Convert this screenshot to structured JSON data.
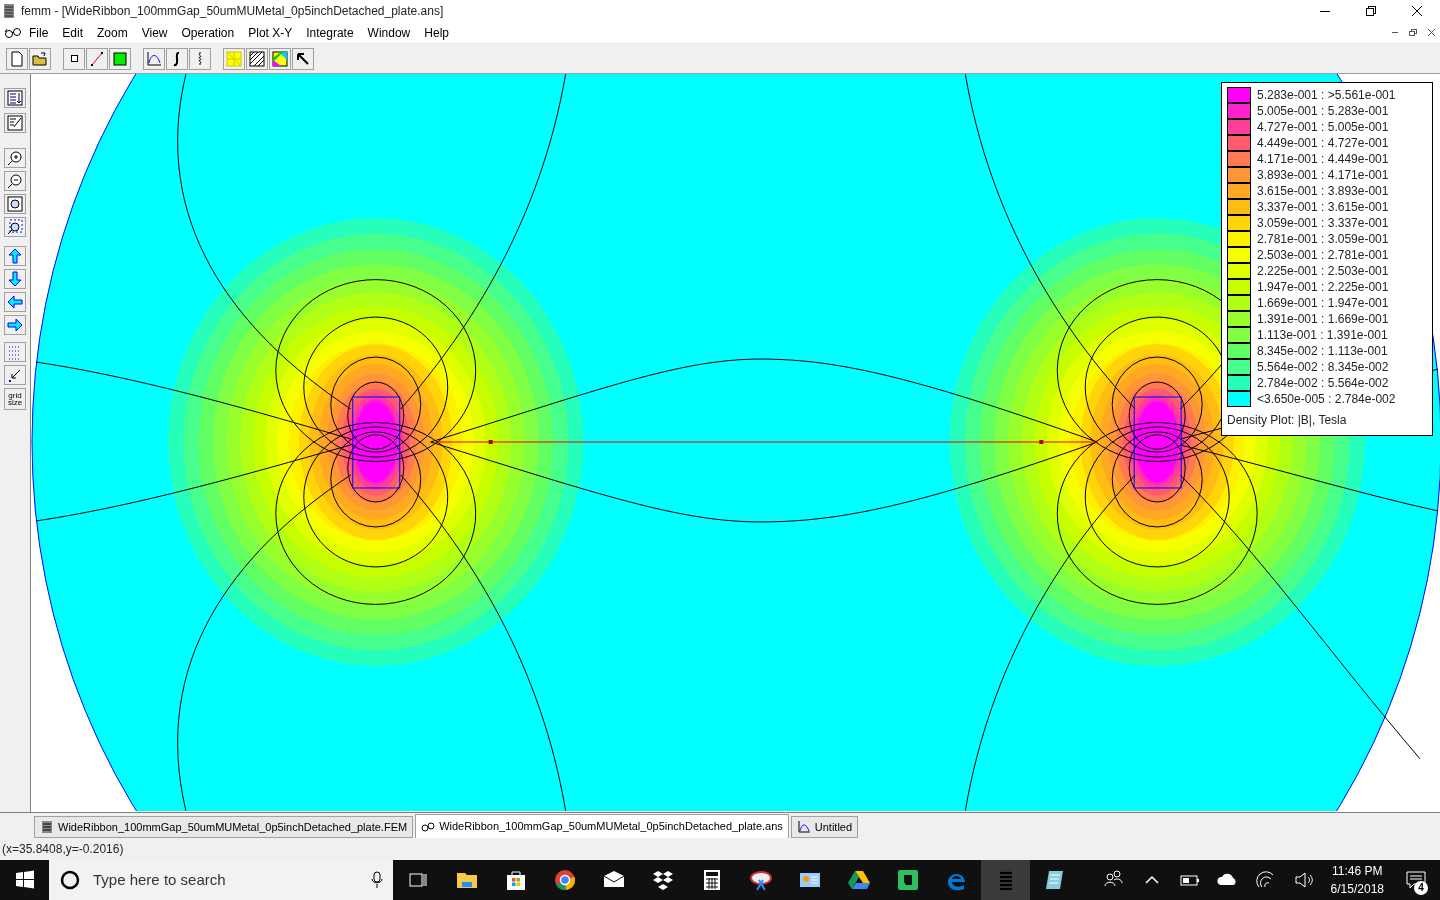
{
  "window": {
    "title": "femm - [WideRibbon_100mmGap_50umMUMetal_0p5inchDetached_plate.ans]"
  },
  "menu": [
    "File",
    "Edit",
    "Zoom",
    "View",
    "Operation",
    "Plot X-Y",
    "Integrate",
    "Window",
    "Help"
  ],
  "side_toolbar": {
    "grid_size_label": "grid size"
  },
  "legend": {
    "rows": [
      {
        "range": "5.283e-001 : >5.561e-001",
        "color": "#ff00ff"
      },
      {
        "range": "5.005e-001 : 5.283e-001",
        "color": "#ff22cc"
      },
      {
        "range": "4.727e-001 : 5.005e-001",
        "color": "#ff3e99"
      },
      {
        "range": "4.449e-001 : 4.727e-001",
        "color": "#ff5a70"
      },
      {
        "range": "4.171e-001 : 4.449e-001",
        "color": "#ff7a50"
      },
      {
        "range": "3.893e-001 : 4.171e-001",
        "color": "#ff9636"
      },
      {
        "range": "3.615e-001 : 3.893e-001",
        "color": "#ffa824"
      },
      {
        "range": "3.337e-001 : 3.615e-001",
        "color": "#ffbc12"
      },
      {
        "range": "3.059e-001 : 3.337e-001",
        "color": "#ffd408"
      },
      {
        "range": "2.781e-001 : 3.059e-001",
        "color": "#fff000"
      },
      {
        "range": "2.503e-001 : 2.781e-001",
        "color": "#f6ff00"
      },
      {
        "range": "2.225e-001 : 2.503e-001",
        "color": "#e0ff00"
      },
      {
        "range": "1.947e-001 : 2.225e-001",
        "color": "#c8ff00"
      },
      {
        "range": "1.669e-001 : 1.947e-001",
        "color": "#b0ff14"
      },
      {
        "range": "1.391e-001 : 1.669e-001",
        "color": "#98ff2c"
      },
      {
        "range": "1.113e-001 : 1.391e-001",
        "color": "#80ff44"
      },
      {
        "range": "8.345e-002 : 1.113e-001",
        "color": "#62ff64"
      },
      {
        "range": "5.564e-002 : 8.345e-002",
        "color": "#46ff8c"
      },
      {
        "range": "2.784e-002 : 5.564e-002",
        "color": "#26ffbc"
      },
      {
        "range": "<3.650e-005 : 2.784e-002",
        "color": "#00ffff"
      }
    ],
    "caption": "Density Plot: |B|, Tesla"
  },
  "document_tabs": [
    {
      "label": "WideRibbon_100mmGap_50umMUMetal_0p5inchDetached_plate.FEM",
      "kind": "fem",
      "selected": false
    },
    {
      "label": "WideRibbon_100mmGap_50umMUMetal_0p5inchDetached_plate.ans",
      "kind": "ans",
      "selected": true
    },
    {
      "label": "Untitled",
      "kind": "plot",
      "selected": false
    }
  ],
  "status_bar": "(x=35.8408,y=-0.2016)",
  "taskbar": {
    "search": {
      "placeholder": "Type here to search"
    },
    "time": "11:46 PM",
    "date": "6/15/2018",
    "notification_count": "4"
  }
}
